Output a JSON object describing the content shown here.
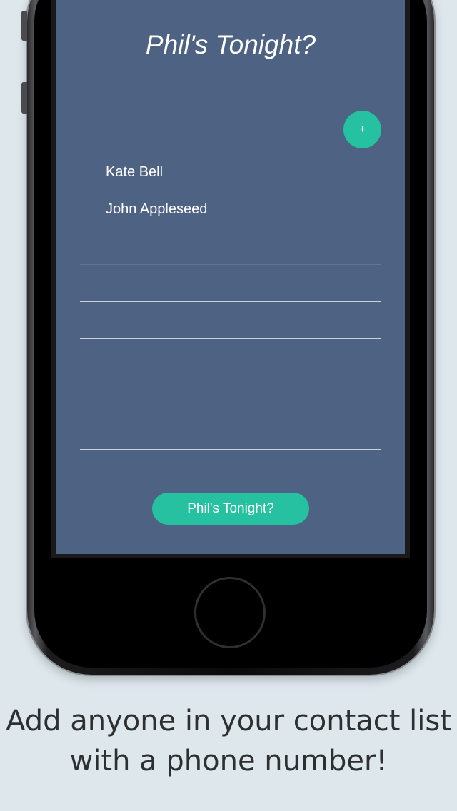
{
  "app": {
    "title": "Phil's Tonight?",
    "add_button_label": "+",
    "cta_label": "Phil's Tonight?"
  },
  "contacts": [
    {
      "name": "Kate Bell"
    },
    {
      "name": "John Appleseed"
    }
  ],
  "caption": {
    "line1": "Add anyone in your contact list",
    "line2": "with a phone number!"
  },
  "colors": {
    "screen_background": "#4e6283",
    "accent": "#25c1a0",
    "page_background": "#dde7ec"
  }
}
